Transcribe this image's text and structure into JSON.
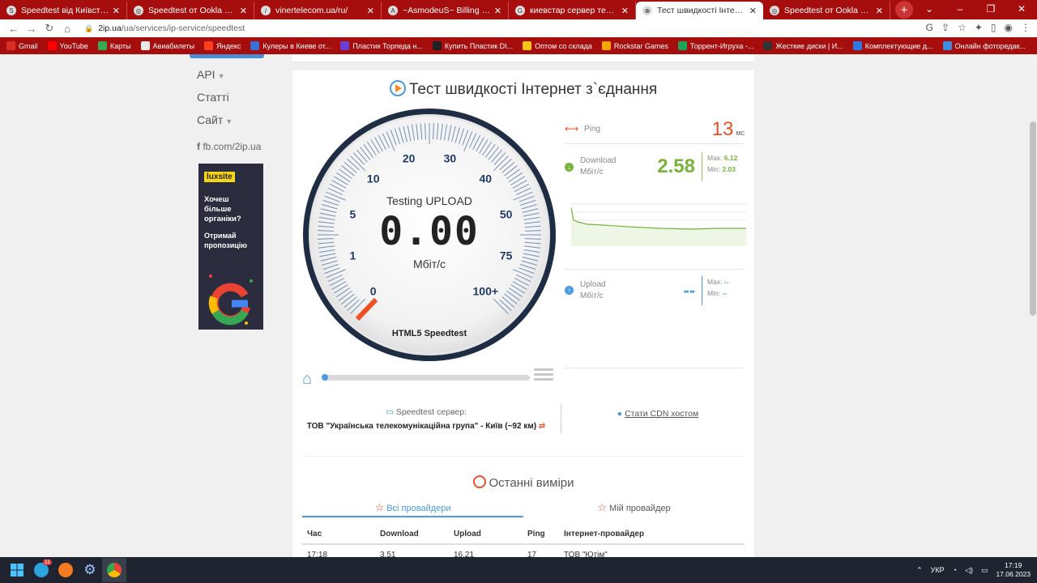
{
  "browser": {
    "tabs": [
      {
        "title": "Speedtest від Київстар ⊳ Онла",
        "fav": "S",
        "active": false
      },
      {
        "title": "Speedtest от Ookla — глобаль",
        "fav": "◎",
        "active": false
      },
      {
        "title": "vinertelecom.ua/ru/",
        "fav": "/",
        "active": false
      },
      {
        "title": "~AsmodeuS~ Billing System",
        "fav": "A",
        "active": false
      },
      {
        "title": "киевстар сервер тест интернет",
        "fav": "G",
        "active": false
      },
      {
        "title": "Тест швидкості Інтернет з`єдна",
        "fav": "⊕",
        "active": true
      },
      {
        "title": "Speedtest от Ookla — глобаль",
        "fav": "◎",
        "active": false
      }
    ],
    "url_host": "2ip.ua",
    "url_path": "/ua/services/ip-service/speedtest",
    "bookmarks": [
      "Gmail",
      "YouTube",
      "Карты",
      "Авиабилеты",
      "Яндекс",
      "Кулеры в Киеве от...",
      "Пластик Торпеда н...",
      "Купить Пластик DI...",
      "Оптом со склада",
      "Rockstar Games",
      "Торрент-Игруха -...",
      "Жесткие диски | И...",
      "Комплектующие д...",
      "Онлайн фоторедак..."
    ],
    "bookmark_colors": [
      "#d93025",
      "#ff0000",
      "#34a853",
      "#e8e8e8",
      "#fc3f1d",
      "#3a6fd8",
      "#6a3fd8",
      "#222222",
      "#f5c518",
      "#f5a500",
      "#1fa35b",
      "#333333",
      "#2c7be5",
      "#3c8dde"
    ]
  },
  "sidebar": {
    "items": [
      "API",
      "Статті",
      "Сайт"
    ],
    "fb": "fb.com/2ip.ua",
    "ad": {
      "logo": "luxsite",
      "text1": "Хочеш більше органіки?",
      "text2": "Отримай пропозицію"
    }
  },
  "main": {
    "title": "Тест швидкості Інтернет з`єднання",
    "gauge": {
      "status": "Testing UPLOAD",
      "value": "0.00",
      "unit": "Мбіт/с",
      "footer": "HTML5 Speedtest",
      "ticks": [
        "0",
        "1",
        "5",
        "10",
        "20",
        "30",
        "40",
        "50",
        "75",
        "100+"
      ]
    },
    "ping": {
      "label": "Ping",
      "value": "13",
      "unit": "мс"
    },
    "download": {
      "label": "Download",
      "unit": "Мбіт/с",
      "value": "2.58",
      "max_label": "Max:",
      "max": "6.12",
      "min_label": "Min:",
      "min": "2.03"
    },
    "upload": {
      "label": "Upload",
      "unit": "Мбіт/с",
      "value": "--",
      "max_label": "Max:",
      "max": "--",
      "min_label": "Min:",
      "min": "--"
    },
    "server": {
      "label": "Speedtest сервер:",
      "value": "ТОВ \"Українська телекомунікаційна група\" - Київ (~92 км)"
    },
    "cdn": "Стати CDN хостом",
    "recent": {
      "title": "Останні виміри",
      "tabs": [
        "Всі провайдери",
        "Мій провайдер"
      ],
      "columns": [
        "Час",
        "Download",
        "Upload",
        "Ping",
        "Інтернет-провайдер"
      ],
      "rows": [
        [
          "17:18",
          "3.51",
          "16.21",
          "17",
          "ТОВ \"Ютім\""
        ]
      ]
    }
  },
  "taskbar": {
    "badge": "11",
    "lang": "УКР",
    "time": "17:19",
    "date": "17.06.2023"
  }
}
